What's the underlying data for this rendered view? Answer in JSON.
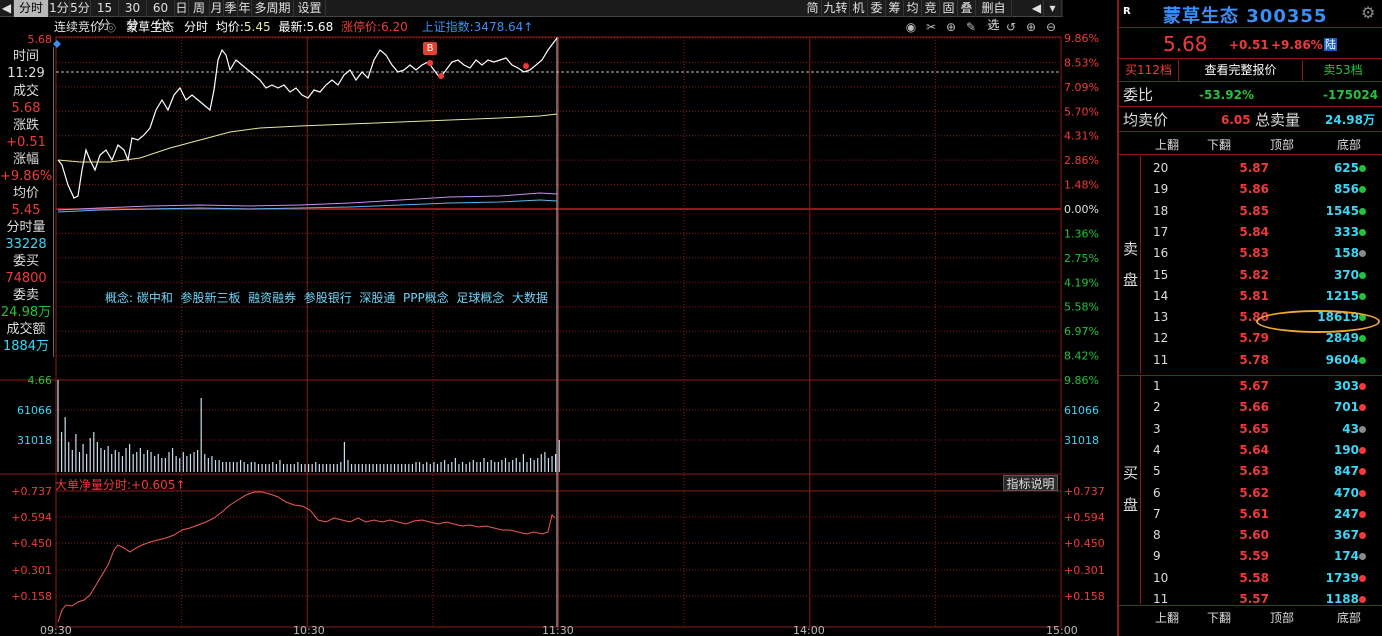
{
  "toolbar": {
    "left_tabs": [
      "分时",
      "1分",
      "5分",
      "15分",
      "30分",
      "60分",
      "日",
      "周",
      "月",
      "季",
      "年",
      "多周期",
      "设置"
    ],
    "right_tabs": [
      "简",
      "九转",
      "机",
      "委",
      "筹",
      "均",
      "竞",
      "固",
      "叠",
      "删自选"
    ]
  },
  "infobar": {
    "mode": "连续竞价",
    "stock_name": "蒙草生态",
    "view": "分时",
    "avg_label": "均价:",
    "avg_value": "5.45",
    "latest_label": "最新:",
    "latest_value": "5.68",
    "limit_label": "涨停价:",
    "limit_value": "6.20",
    "index_label": "上证指数:",
    "index_value": "3478.64↑"
  },
  "left_panel": {
    "top_price": "5.68",
    "time_label": "时间",
    "time_value": "11:29",
    "deal_label": "成交",
    "deal_value": "5.68",
    "change_label": "涨跌",
    "change_value": "+0.51",
    "pct_label": "涨幅",
    "pct_value": "+9.86%",
    "avg_label": "均价",
    "avg_value": "5.45",
    "vol_label": "分时量",
    "vol_value": "33228",
    "bid_label": "委买",
    "bid_value": "74800",
    "ask_label": "委卖",
    "ask_value": "24.98万",
    "amount_label": "成交额",
    "amount_value": "1884万"
  },
  "price_axis_right": [
    "9.86%",
    "8.53%",
    "7.09%",
    "5.70%",
    "4.31%",
    "2.86%",
    "1.48%",
    "0.00%",
    "1.36%",
    "2.75%",
    "4.19%",
    "5.58%",
    "6.97%",
    "8.42%",
    "9.86%"
  ],
  "volume_axis_left": [
    "4.66",
    "61066",
    "31018"
  ],
  "volume_axis_right": [
    "61066",
    "31018"
  ],
  "concepts": "概念: 碳中和  参股新三板  融资融券  参股银行  深股通  PPP概念  足球概念  大数据",
  "trade_marker": "B",
  "indicator": {
    "label": "大单净量分时:",
    "value": "+0.605↑",
    "explain_button": "指标说明",
    "axis": [
      "+0.737",
      "+0.594",
      "+0.450",
      "+0.301",
      "+0.158"
    ]
  },
  "time_axis": [
    "09:30",
    "10:30",
    "11:30",
    "14:00",
    "15:00"
  ],
  "right_panel": {
    "logo": "R",
    "title": "蒙草生态 300355",
    "price": "5.68",
    "change": "+0.51",
    "pct": "+9.86%",
    "market_tag": "陆",
    "buy_levels_button": "买112档",
    "full_quote_button": "查看完整报价",
    "sell_levels_button": "卖53档",
    "ratio_label": "委比",
    "ratio_pct": "-53.92%",
    "ratio_diff": "-175024",
    "avg_ask_label": "均卖价",
    "avg_ask_value": "6.05",
    "total_ask_label": "总卖量",
    "total_ask_value": "24.98万",
    "nav": [
      "上翻",
      "下翻",
      "顶部",
      "底部"
    ],
    "sell_side_label": [
      "卖",
      "盘"
    ],
    "buy_side_label": [
      "买",
      "盘"
    ],
    "sell_orders": [
      {
        "level": "20",
        "price": "5.87",
        "vol": "625",
        "dot": "#22c33a"
      },
      {
        "level": "19",
        "price": "5.86",
        "vol": "856",
        "dot": "#22c33a"
      },
      {
        "level": "18",
        "price": "5.85",
        "vol": "1545",
        "dot": "#22c33a"
      },
      {
        "level": "17",
        "price": "5.84",
        "vol": "333",
        "dot": "#22c33a"
      },
      {
        "level": "16",
        "price": "5.83",
        "vol": "158",
        "dot": "#8a8a8a"
      },
      {
        "level": "15",
        "price": "5.82",
        "vol": "370",
        "dot": "#22c33a"
      },
      {
        "level": "14",
        "price": "5.81",
        "vol": "1215",
        "dot": "#22c33a"
      },
      {
        "level": "13",
        "price": "5.80",
        "vol": "18619",
        "dot": "#22c33a"
      },
      {
        "level": "12",
        "price": "5.79",
        "vol": "2849",
        "dot": "#22c33a"
      },
      {
        "level": "11",
        "price": "5.78",
        "vol": "9604",
        "dot": "#22c33a"
      }
    ],
    "buy_orders": [
      {
        "level": "1",
        "price": "5.67",
        "vol": "303",
        "dot": "#f03a3a"
      },
      {
        "level": "2",
        "price": "5.66",
        "vol": "701",
        "dot": "#f03a3a"
      },
      {
        "level": "3",
        "price": "5.65",
        "vol": "43",
        "dot": "#8a8a8a"
      },
      {
        "level": "4",
        "price": "5.64",
        "vol": "190",
        "dot": "#f03a3a"
      },
      {
        "level": "5",
        "price": "5.63",
        "vol": "847",
        "dot": "#f03a3a"
      },
      {
        "level": "6",
        "price": "5.62",
        "vol": "470",
        "dot": "#f03a3a"
      },
      {
        "level": "7",
        "price": "5.61",
        "vol": "247",
        "dot": "#f03a3a"
      },
      {
        "level": "8",
        "price": "5.60",
        "vol": "367",
        "dot": "#f03a3a"
      },
      {
        "level": "9",
        "price": "5.59",
        "vol": "174",
        "dot": "#8a8a8a"
      },
      {
        "level": "10",
        "price": "5.58",
        "vol": "1739",
        "dot": "#f03a3a"
      },
      {
        "level": "11",
        "price": "5.57",
        "vol": "1188",
        "dot": "#f03a3a"
      }
    ]
  },
  "colors": {
    "up": "#f03a3a",
    "down": "#22c33a",
    "cyan": "#3ad7f6",
    "gridline": "#8b1a1a",
    "price_line": "#ffffff",
    "avg_line": "#e8e8a0",
    "highlight": "#f0a830"
  }
}
